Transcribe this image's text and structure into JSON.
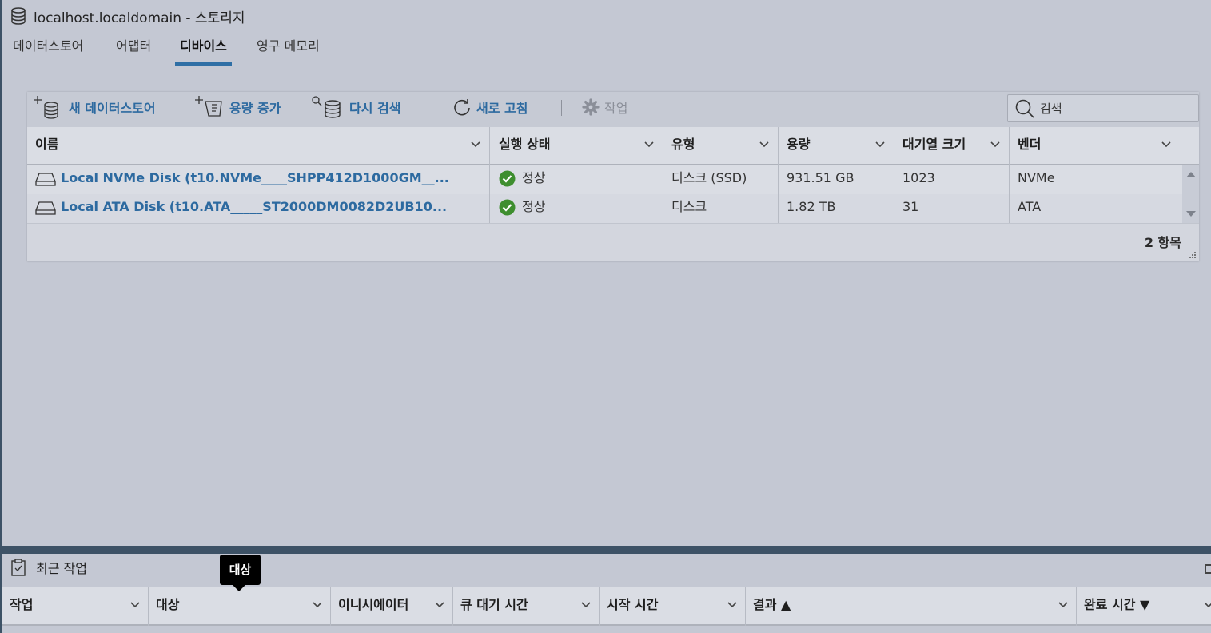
{
  "window": {
    "title": "localhost.localdomain - 스토리지",
    "icon": "database-icon"
  },
  "tabs": [
    {
      "label": "데이터스토어",
      "active": false
    },
    {
      "label": "어댑터",
      "active": false
    },
    {
      "label": "디바이스",
      "active": true
    },
    {
      "label": "영구 메모리",
      "active": false
    }
  ],
  "toolbar": {
    "new_datastore": "새 데이터스토어",
    "increase_capacity": "용량 증가",
    "rescan": "다시 검색",
    "refresh": "새로 고침",
    "actions": "작업",
    "search_placeholder": "검색"
  },
  "devices_table": {
    "columns": [
      "이름",
      "실행 상태",
      "유형",
      "용량",
      "대기열 크기",
      "벤더"
    ],
    "rows": [
      {
        "name": "Local NVMe Disk (t10.NVMe____SHPP412D1000GM__...",
        "status": "정상",
        "type": "디스크 (SSD)",
        "capacity": "931.51 GB",
        "queue_depth": "1023",
        "vendor": "NVMe"
      },
      {
        "name": "Local ATA Disk (t10.ATA_____ST2000DM0082D2UB10...",
        "status": "정상",
        "type": "디스크",
        "capacity": "1.82 TB",
        "queue_depth": "31",
        "vendor": "ATA"
      }
    ],
    "item_count": "2 항목"
  },
  "recent_tasks": {
    "title": "최근 작업",
    "columns": [
      "작업",
      "대상",
      "이니시에이터",
      "큐 대기 시간",
      "시작 시간",
      "결과 ▲",
      "완료 시간 ▼"
    ],
    "tooltip": "대상"
  },
  "colors": {
    "accent": "#2f6fa5",
    "link": "#2d6aa0",
    "ok": "#3e8e2f",
    "panel": "#c4c8d3"
  }
}
